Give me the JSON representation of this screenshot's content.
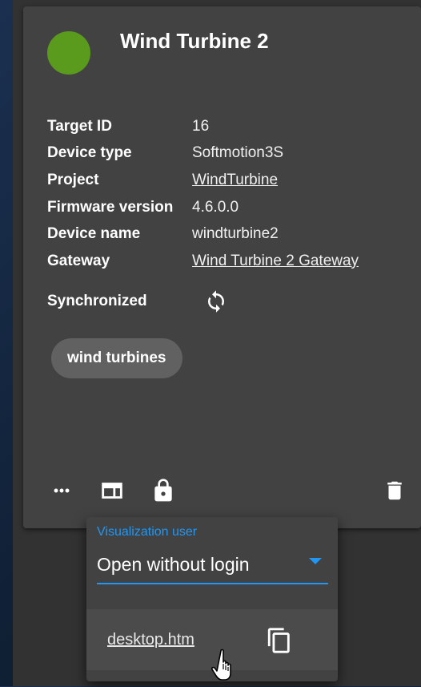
{
  "card": {
    "title": "Wind Turbine 2",
    "status_color": "#5a9a1c",
    "properties": [
      {
        "label": "Target ID",
        "value": "16",
        "link": false
      },
      {
        "label": "Device type",
        "value": "Softmotion3S",
        "link": false
      },
      {
        "label": "Project",
        "value": "WindTurbine",
        "link": true
      },
      {
        "label": "Firmware version",
        "value": "4.6.0.0",
        "link": false
      },
      {
        "label": "Device name",
        "value": "windturbine2",
        "link": false
      },
      {
        "label": "Gateway",
        "value": "Wind Turbine 2 Gateway",
        "link": true
      }
    ],
    "synchronized_label": "Synchronized",
    "sync_icon": "sync-icon",
    "tag": "wind turbines",
    "actions": {
      "more_icon": "more-horiz-icon",
      "visualization_icon": "web-asset-icon",
      "lock_icon": "lock-icon",
      "delete_icon": "delete-icon"
    }
  },
  "popup": {
    "field_label": "Visualization user",
    "field_value": "Open without login",
    "accent_color": "#2196f3",
    "link": "desktop.htm",
    "copy_icon": "copy-icon"
  }
}
